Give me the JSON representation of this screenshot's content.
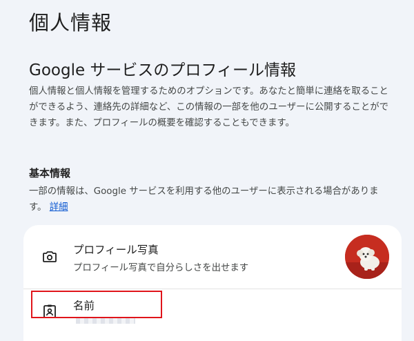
{
  "page": {
    "title": "個人情報"
  },
  "profile_section": {
    "title": "Google サービスのプロフィール情報",
    "description": "個人情報と個人情報を管理するためのオプションです。あなたと簡単に連絡を取ることができるよう、連絡先の詳細など、この情報の一部を他のユーザーに公開することができます。また、プロフィールの概要を確認することもできます。"
  },
  "basic_info": {
    "title": "基本情報",
    "description": "一部の情報は、Google サービスを利用する他のユーザーに表示される場合があります。",
    "link_label": "詳細"
  },
  "rows": {
    "photo": {
      "label": "プロフィール写真",
      "value": "プロフィール写真で自分らしさを出せます",
      "icon": "camera-icon"
    },
    "name": {
      "label": "名前",
      "icon": "badge-icon"
    }
  },
  "colors": {
    "background": "#f1f4f9",
    "card": "#ffffff",
    "link": "#0b57d0",
    "highlight": "#e0141a",
    "avatar_bg": "#c62d20"
  }
}
